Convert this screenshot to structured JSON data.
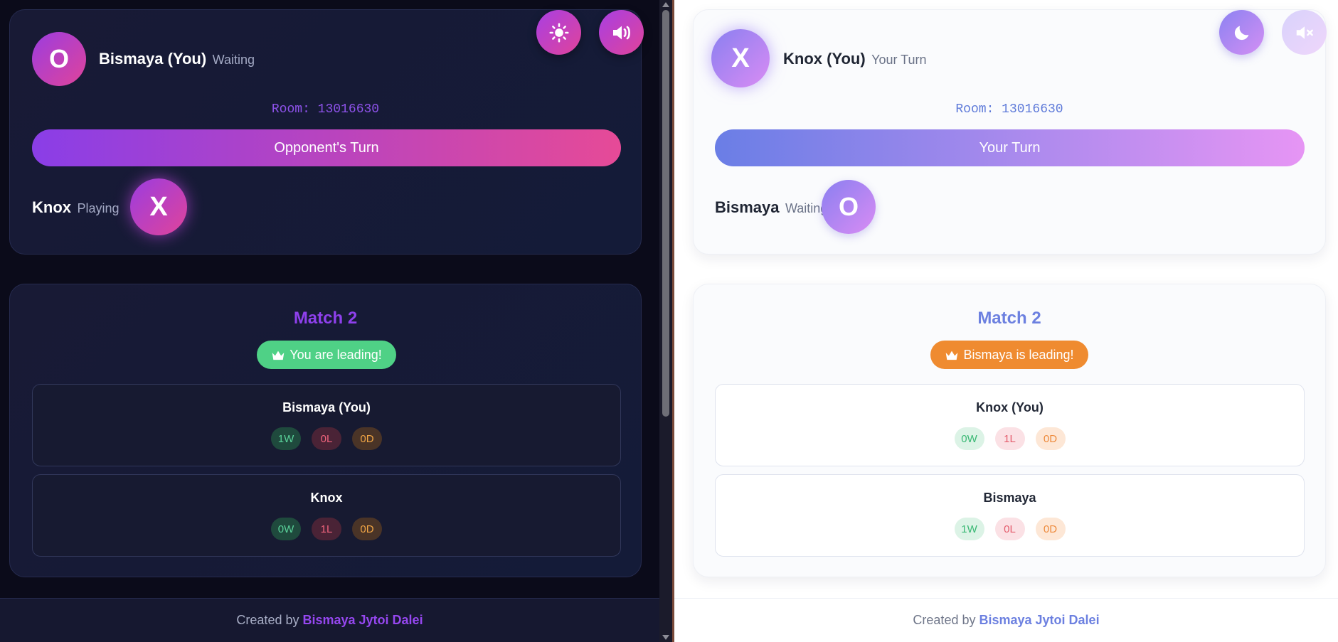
{
  "left": {
    "theme": "dark",
    "me": {
      "symbol": "O",
      "name": "Bismaya (You)",
      "status": "Waiting"
    },
    "room": "Room: 13016630",
    "turn_label": "Opponent's Turn",
    "opponent": {
      "symbol": "X",
      "name": "Knox",
      "status": "Playing"
    },
    "buttons": {
      "theme_icon": "sun-icon",
      "sound_icon": "speaker-on-icon"
    },
    "match": {
      "title": "Match 2",
      "lead_text": "You are leading!",
      "scores": [
        {
          "name": "Bismaya (You)",
          "wins": "1W",
          "losses": "0L",
          "draws": "0D"
        },
        {
          "name": "Knox",
          "wins": "0W",
          "losses": "1L",
          "draws": "0D"
        }
      ]
    },
    "footer": {
      "prefix": "Created by",
      "author": "Bismaya Jytoi Dalei"
    }
  },
  "right": {
    "theme": "light",
    "me": {
      "symbol": "X",
      "name": "Knox (You)",
      "status": "Your Turn"
    },
    "room": "Room: 13016630",
    "turn_label": "Your Turn",
    "opponent": {
      "symbol": "O",
      "name": "Bismaya",
      "status": "Waiting"
    },
    "buttons": {
      "theme_icon": "moon-icon",
      "sound_icon": "speaker-muted-icon"
    },
    "match": {
      "title": "Match 2",
      "lead_text": "Bismaya is leading!",
      "scores": [
        {
          "name": "Knox (You)",
          "wins": "0W",
          "losses": "1L",
          "draws": "0D"
        },
        {
          "name": "Bismaya",
          "wins": "1W",
          "losses": "0L",
          "draws": "0D"
        }
      ]
    },
    "footer": {
      "prefix": "Created by",
      "author": "Bismaya Jytoi Dalei"
    }
  },
  "colors": {
    "dark_accent": "#8e40ec",
    "light_accent": "#6c80e0",
    "dark_lead_badge": "#4fd186",
    "light_lead_badge": "#ef8b30"
  }
}
